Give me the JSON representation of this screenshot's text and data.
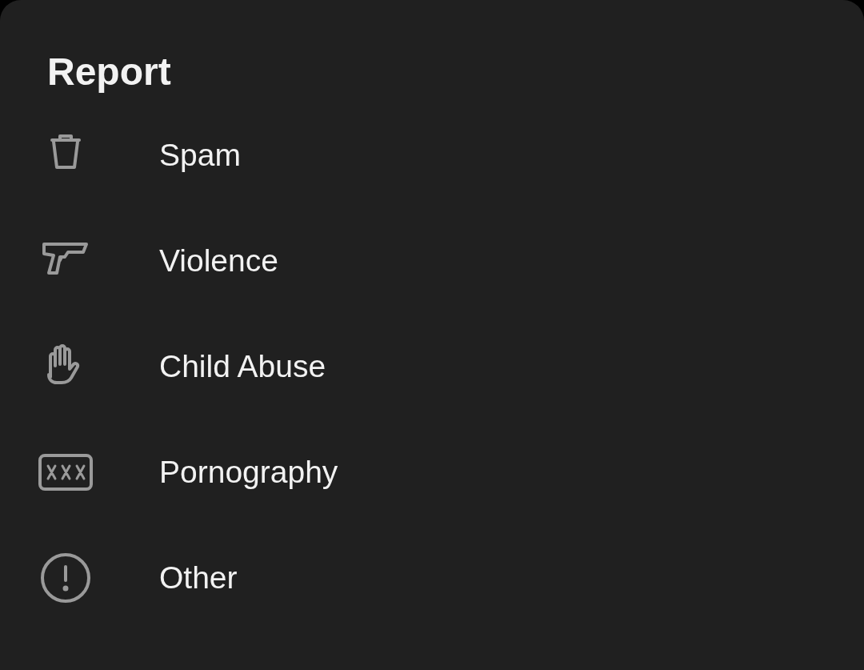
{
  "sheet": {
    "title": "Report"
  },
  "options": [
    {
      "label": "Spam"
    },
    {
      "label": "Violence"
    },
    {
      "label": "Child Abuse"
    },
    {
      "label": "Pornography"
    },
    {
      "label": "Other"
    }
  ]
}
